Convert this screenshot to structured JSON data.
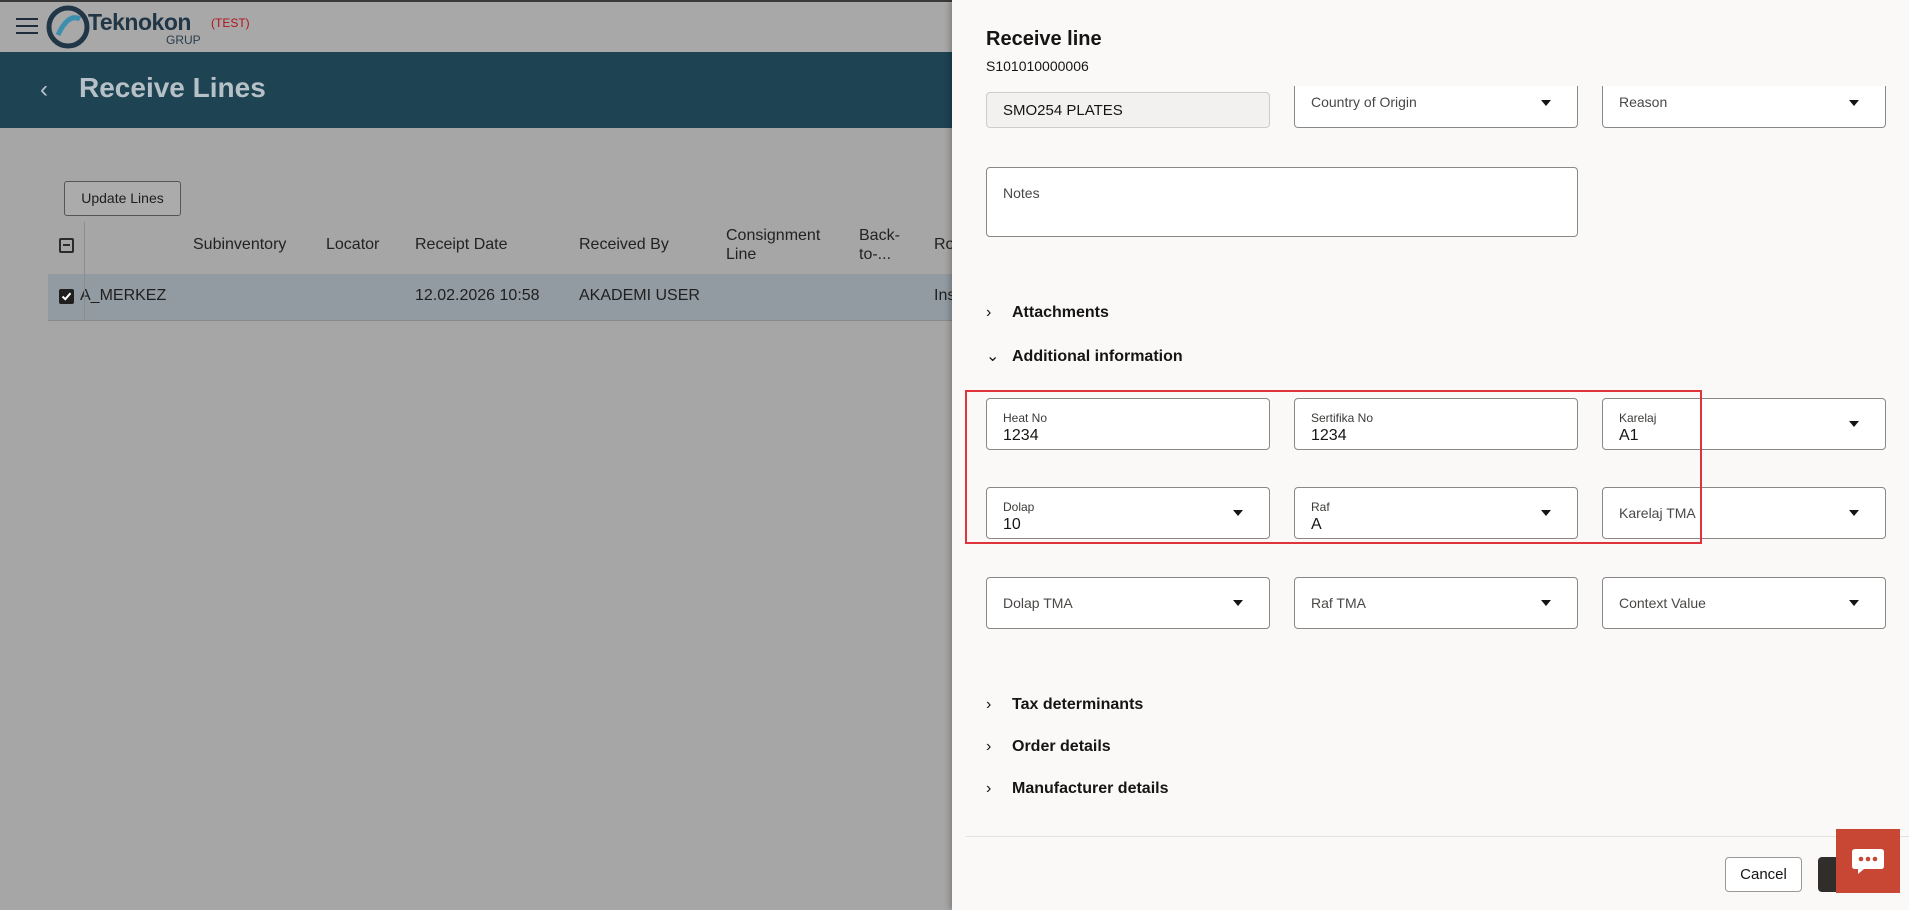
{
  "app": {
    "logo_name": "Teknokon",
    "logo_sub": "GRUP",
    "environment": "(TEST)",
    "page_title": "Receive Lines",
    "update_button": "Update Lines"
  },
  "grid": {
    "columns": [
      "Subinventory",
      "Locator",
      "Receipt Date",
      "Received By",
      "Consignment Line",
      "Back-to-...",
      "Ro"
    ],
    "row": {
      "first_cell": "A_MERKEZ",
      "subinventory": "",
      "locator": "",
      "receipt_date": "12.02.2026 10:58",
      "received_by": "AKADEMI USER",
      "consignment_line": "",
      "back_to": "",
      "ro": "Ins"
    }
  },
  "drawer": {
    "title": "Receive line",
    "subtitle": "S101010000006",
    "item_description": "SMO254 PLATES",
    "country_placeholder": "Country of Origin",
    "reason_placeholder": "Reason",
    "notes_label": "Notes",
    "sections": {
      "attachments": "Attachments",
      "additional": "Additional information",
      "tax": "Tax determinants",
      "order": "Order details",
      "manufacturer": "Manufacturer details"
    },
    "fields": {
      "heat_no": {
        "label": "Heat No",
        "value": "1234"
      },
      "sertifika_no": {
        "label": "Sertifika No",
        "value": "1234"
      },
      "karelaj": {
        "label": "Karelaj",
        "value": "A1"
      },
      "dolap": {
        "label": "Dolap",
        "value": "10"
      },
      "raf": {
        "label": "Raf",
        "value": "A"
      },
      "karelaj_tma": {
        "label": "Karelaj TMA"
      },
      "dolap_tma": {
        "label": "Dolap TMA"
      },
      "raf_tma": {
        "label": "Raf TMA"
      },
      "context_value": {
        "label": "Context Value"
      }
    },
    "cancel_button": "Cancel"
  },
  "colors": {
    "header_bar": "#1e4353",
    "highlight": "#e0343d",
    "chat_button": "#c74634",
    "env_tag": "#b2141b"
  }
}
